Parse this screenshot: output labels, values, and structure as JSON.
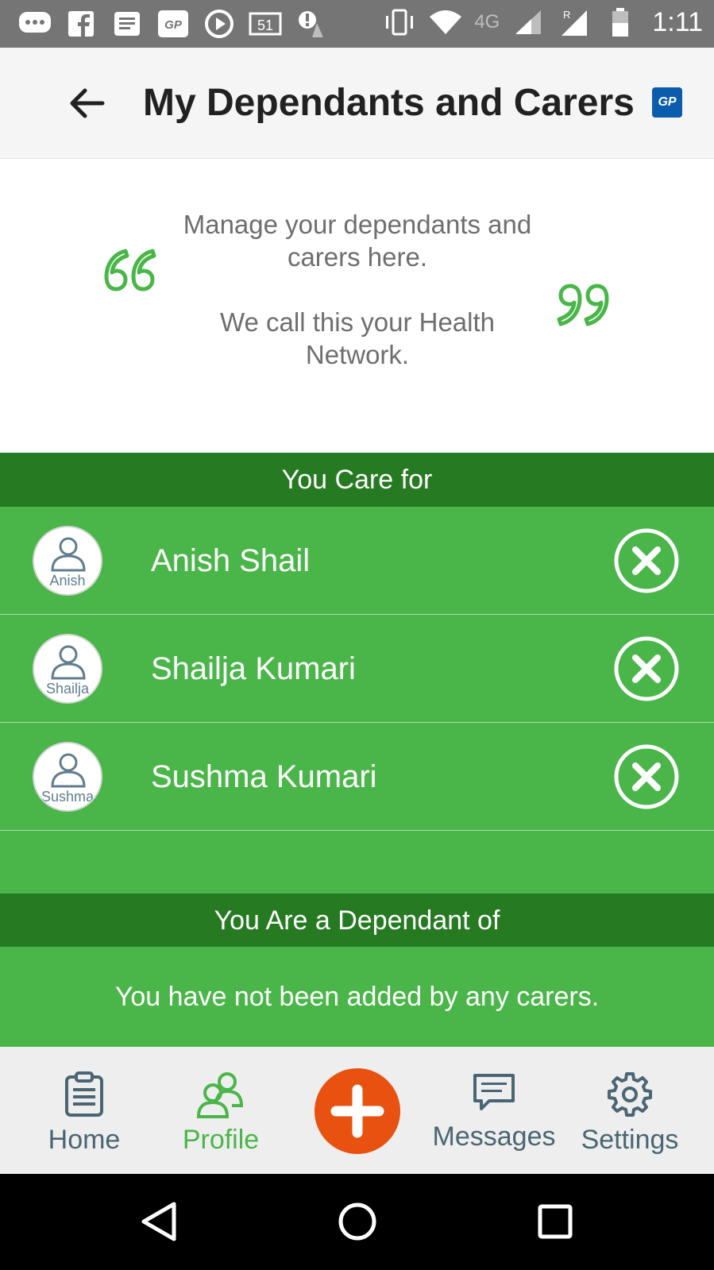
{
  "status_bar": {
    "time": "1:11",
    "network_type": "4G",
    "roaming": "R",
    "notification_icons": [
      "chat-icon",
      "facebook-icon",
      "news-icon",
      "gp-icon",
      "play-icon",
      "calendar-icon",
      "alert-icon"
    ],
    "calendar_day": "51"
  },
  "app_bar": {
    "title": "My Dependants and Carers",
    "badge": "GP"
  },
  "intro": {
    "line1": "Manage your dependants and carers here.",
    "line2": "We call this your Health Network.",
    "accent_color": "#4ab649"
  },
  "care_section": {
    "header": "You Care for",
    "people": [
      {
        "name": "Anish Shail",
        "avatar_label": "Anish"
      },
      {
        "name": "Shailja Kumari",
        "avatar_label": "Shailja"
      },
      {
        "name": "Sushma Kumari",
        "avatar_label": "Sushma"
      }
    ]
  },
  "dependant_section": {
    "header": "You Are a Dependant of",
    "empty_message": "You have not been added by any carers."
  },
  "bottom_nav": {
    "items": [
      {
        "label": "Home",
        "icon": "clipboard-icon"
      },
      {
        "label": "Profile",
        "icon": "users-icon",
        "active": true
      },
      {
        "label": "Messages",
        "icon": "message-icon"
      },
      {
        "label": "Settings",
        "icon": "gear-icon"
      }
    ],
    "fab_icon": "plus-icon",
    "fab_color": "#e8510f",
    "active_color": "#4ab649"
  },
  "colors": {
    "header_green": "#267a22",
    "list_green": "#4ab649"
  }
}
